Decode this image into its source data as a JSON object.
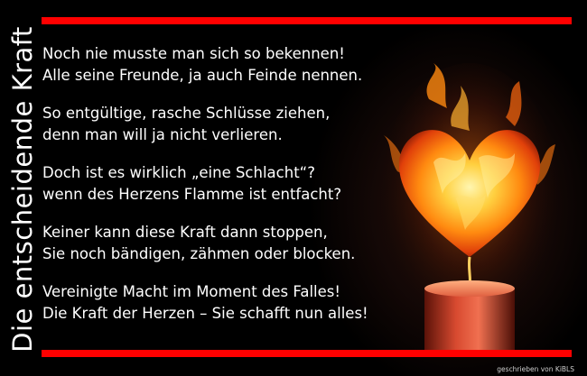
{
  "title": "Die entscheidende Kraft",
  "poem": {
    "stanzas": [
      [
        "Noch nie musste man sich so bekennen!",
        "Alle seine Freunde, ja auch Feinde nennen."
      ],
      [
        "So entgültige, rasche Schlüsse ziehen,",
        "denn man will ja nicht verlieren."
      ],
      [
        "Doch ist es wirklich „eine Schlacht“?",
        "wenn des Herzens Flamme ist entfacht?"
      ],
      [
        "Keiner kann diese Kraft dann stoppen,",
        "Sie noch bändigen, zähmen oder blocken."
      ],
      [
        "Vereinigte Macht im Moment des Falles!",
        "Die Kraft der Herzen – Sie schafft nun alles!"
      ]
    ]
  },
  "credit": "geschrieben von KiBLS",
  "colors": {
    "accent_bar": "#ff0000",
    "background": "#000000",
    "text": "#ffffff"
  },
  "icons": {
    "illustration": "flaming-heart-candle"
  }
}
